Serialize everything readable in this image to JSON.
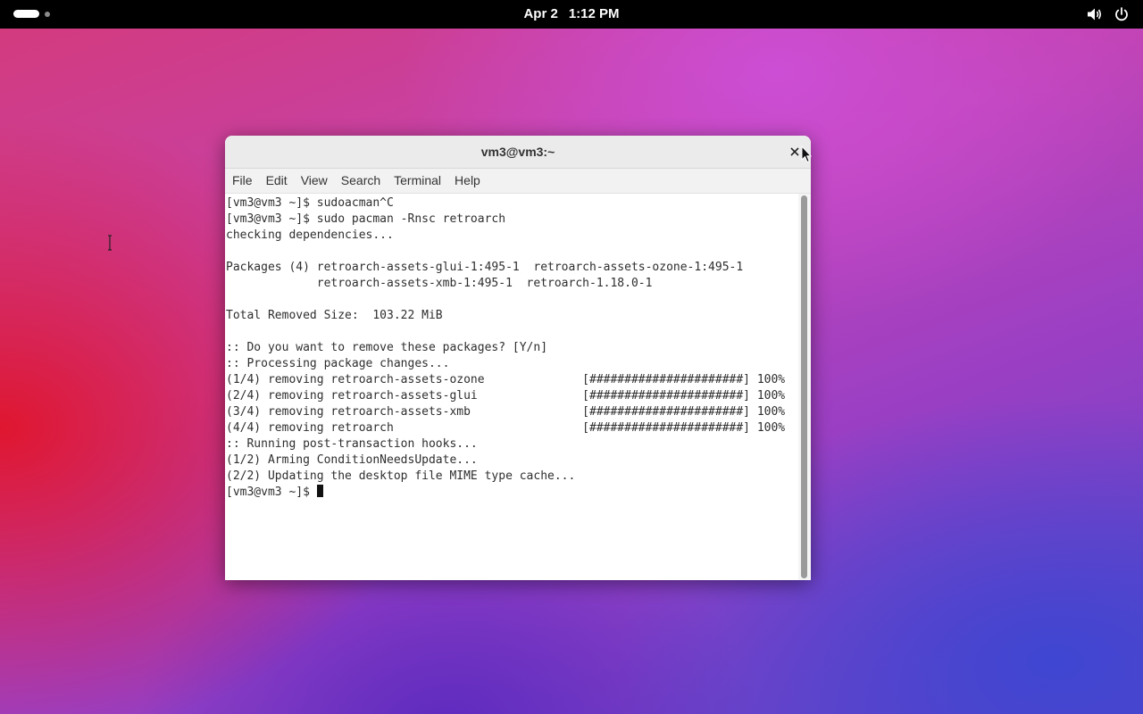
{
  "topbar": {
    "date": "Apr 2",
    "time": "1:12 PM"
  },
  "window": {
    "title": "vm3@vm3:~",
    "menu": [
      "File",
      "Edit",
      "View",
      "Search",
      "Terminal",
      "Help"
    ]
  },
  "terminal": {
    "lines": [
      "[vm3@vm3 ~]$ sudoacman^C",
      "[vm3@vm3 ~]$ sudo pacman -Rnsc retroarch",
      "checking dependencies...",
      "",
      "Packages (4) retroarch-assets-glui-1:495-1  retroarch-assets-ozone-1:495-1",
      "             retroarch-assets-xmb-1:495-1  retroarch-1.18.0-1",
      "",
      "Total Removed Size:  103.22 MiB",
      "",
      ":: Do you want to remove these packages? [Y/n]",
      ":: Processing package changes...",
      "(1/4) removing retroarch-assets-ozone              [######################] 100%",
      "(2/4) removing retroarch-assets-glui               [######################] 100%",
      "(3/4) removing retroarch-assets-xmb                [######################] 100%",
      "(4/4) removing retroarch                           [######################] 100%",
      ":: Running post-transaction hooks...",
      "(1/2) Arming ConditionNeedsUpdate...",
      "(2/2) Updating the desktop file MIME type cache..."
    ],
    "prompt": "[vm3@vm3 ~]$ "
  },
  "icons": {
    "volume": "volume-icon",
    "power": "power-icon",
    "close": "close-icon"
  }
}
